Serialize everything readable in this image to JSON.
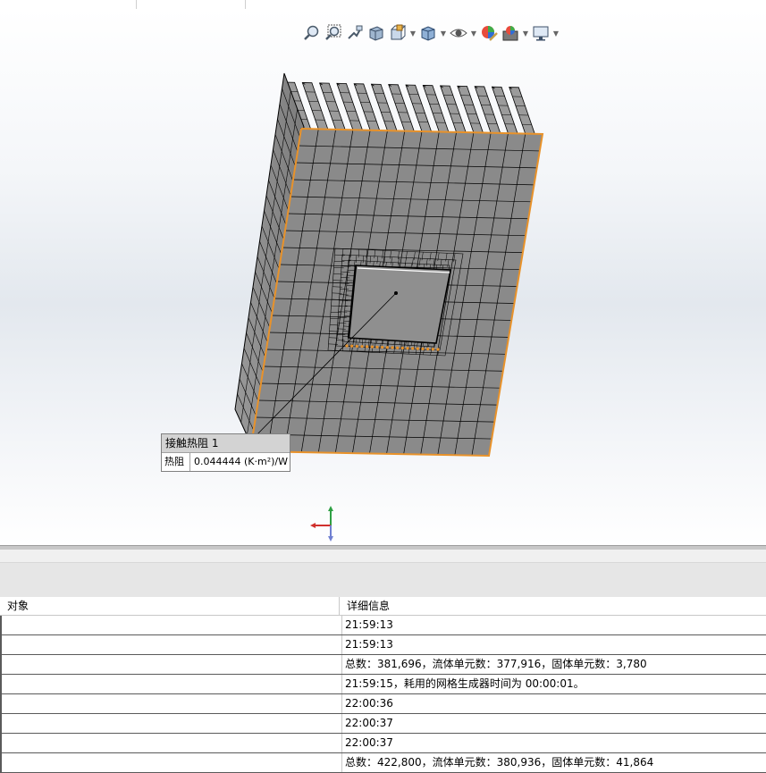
{
  "toolbar": {
    "icons": [
      "zoom-to-fit-icon",
      "zoom-to-area-icon",
      "previous-view-icon",
      "section-view-icon",
      "view-orientation-icon",
      "display-style-icon",
      "hide-show-items-icon",
      "edit-appearance-icon",
      "apply-scene-icon",
      "view-settings-icon"
    ]
  },
  "callout": {
    "title": "接触热阻 1",
    "label": "热阻",
    "value": "0.044444 (K·m²)/W"
  },
  "table": {
    "headers": [
      "对象",
      "详细信息"
    ],
    "rows": [
      {
        "object": "",
        "detail": "21:59:13"
      },
      {
        "object": "",
        "detail": "21:59:13"
      },
      {
        "object": "",
        "detail": "总数：381,696，流体单元数：377,916，固体单元数：3,780"
      },
      {
        "object": "",
        "detail": "21:59:15，耗用的网格生成器时间为 00:00:01。"
      },
      {
        "object": "",
        "detail": "22:00:36"
      },
      {
        "object": "",
        "detail": "22:00:37"
      },
      {
        "object": "",
        "detail": "22:00:37"
      },
      {
        "object": "",
        "detail": "总数：422,800，流体单元数：380,936，固体单元数：41,864"
      }
    ]
  },
  "colors": {
    "mesh_face": "#8a8a8a",
    "mesh_line": "#000000",
    "edge_highlight": "#e8922a",
    "callout_header": "#d3d3d3"
  }
}
